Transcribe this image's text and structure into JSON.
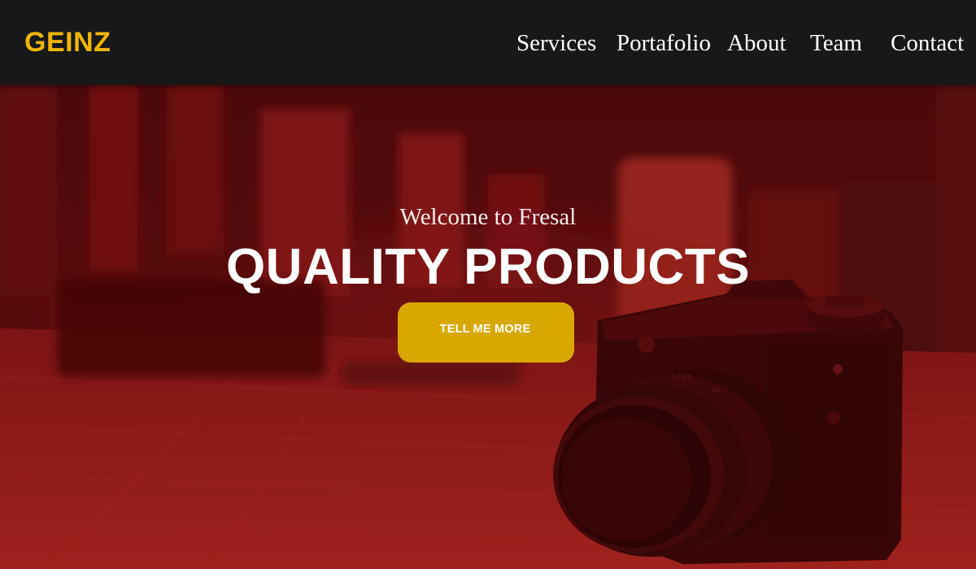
{
  "brand": {
    "name": "GEINZ"
  },
  "nav": {
    "items": [
      {
        "label": "Services"
      },
      {
        "label": "Portafolio"
      },
      {
        "label": "About"
      },
      {
        "label": "Team"
      },
      {
        "label": "Contact"
      }
    ]
  },
  "hero": {
    "subheading": "Welcome to Fresal",
    "heading": "QUALITY PRODUCTS",
    "cta_label": "TELL ME MORE",
    "background": "camera-photo-red-tint"
  },
  "colors": {
    "accent": "#d9a800",
    "brand": "#f0b507",
    "navbar": "#16181a",
    "hero_tint": "#8a1214"
  }
}
